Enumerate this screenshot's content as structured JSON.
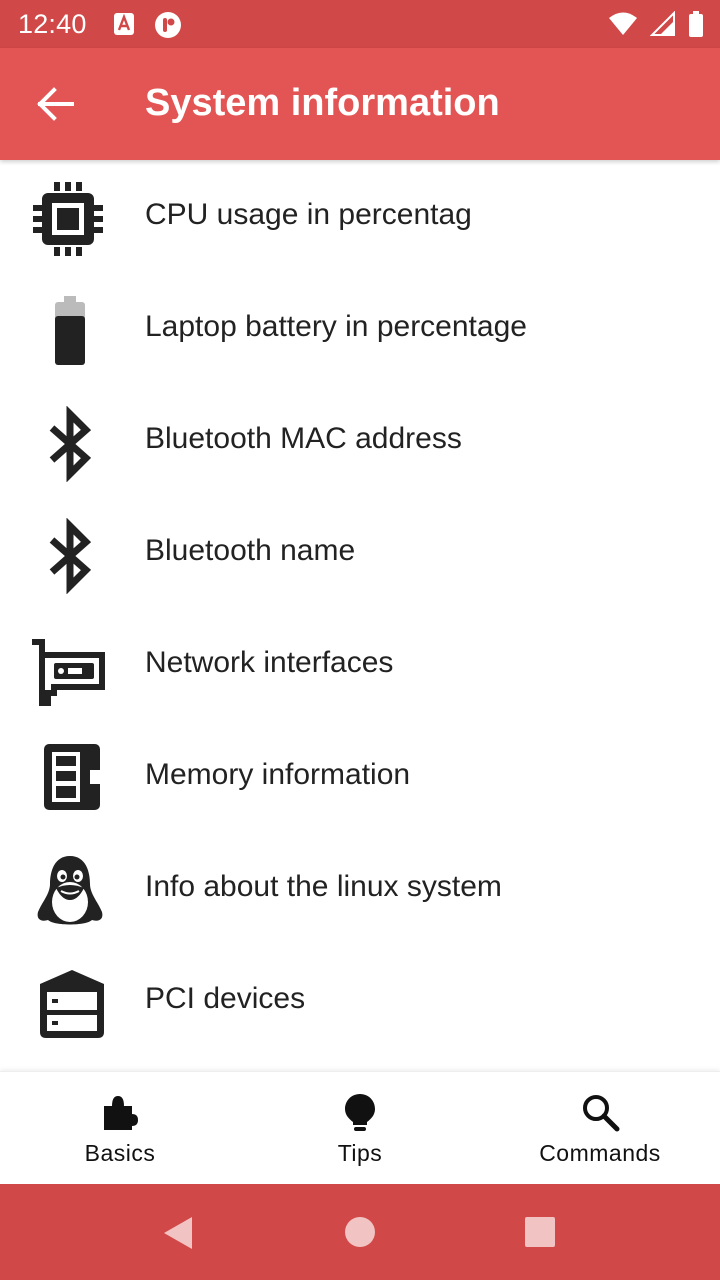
{
  "status_bar": {
    "time": "12:40"
  },
  "app_bar": {
    "title": "System information"
  },
  "items": [
    {
      "label": "CPU usage in percentag",
      "icon": "cpu-icon"
    },
    {
      "label": "Laptop battery in percentage",
      "icon": "battery-icon"
    },
    {
      "label": "Bluetooth MAC address",
      "icon": "bluetooth-icon"
    },
    {
      "label": "Bluetooth name",
      "icon": "bluetooth-icon"
    },
    {
      "label": "Network interfaces",
      "icon": "network-card-icon"
    },
    {
      "label": "Memory information",
      "icon": "memory-icon"
    },
    {
      "label": "Info about the linux system",
      "icon": "linux-penguin-icon"
    },
    {
      "label": "PCI devices",
      "icon": "pci-device-icon"
    }
  ],
  "bottom_nav": {
    "basics": {
      "label": "Basics",
      "icon": "puzzle-icon"
    },
    "tips": {
      "label": "Tips",
      "icon": "lightbulb-icon"
    },
    "commands": {
      "label": "Commands",
      "icon": "search-icon"
    }
  },
  "colors": {
    "status_bar": "#d14848",
    "app_bar": "#e35454",
    "nav_bar": "#d14848",
    "icon": "#222222"
  }
}
